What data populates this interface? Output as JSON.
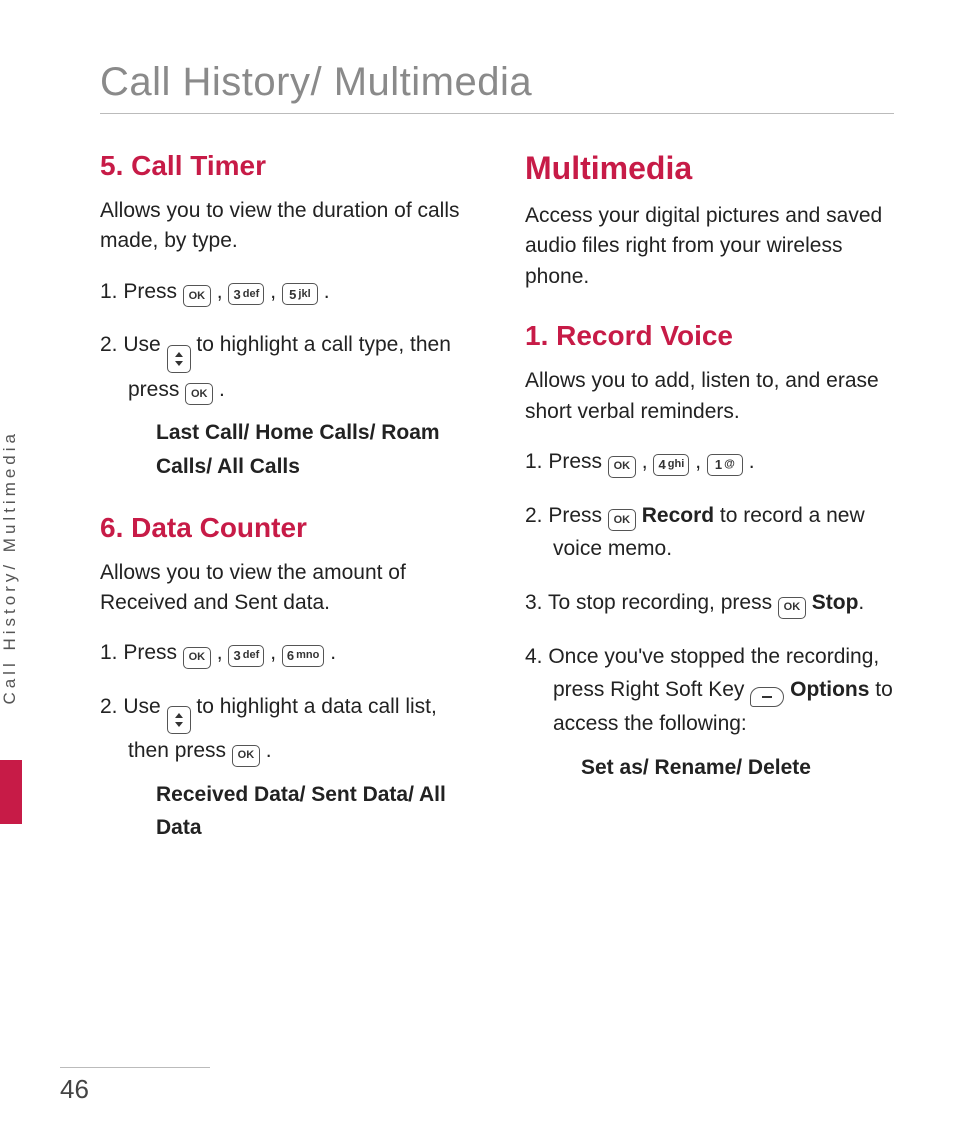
{
  "header": {
    "title": "Call History/ Multimedia"
  },
  "side_tab": "Call History/ Multimedia",
  "page_number": "46",
  "keys": {
    "ok": "OK",
    "k1": {
      "num": "1",
      "sub": "@"
    },
    "k3": {
      "num": "3",
      "sub": "def"
    },
    "k4": {
      "num": "4",
      "sub": "ghi"
    },
    "k5": {
      "num": "5",
      "sub": "jkl"
    },
    "k6": {
      "num": "6",
      "sub": "mno"
    }
  },
  "left": {
    "call_timer": {
      "title": "5. Call Timer",
      "desc": "Allows you to view the duration of calls made, by type.",
      "step1_a": "1. Press ",
      "step1_b": " , ",
      "step1_c": " , ",
      "step1_d": " .",
      "step2_a": "2. Use ",
      "step2_b": " to highlight a call type, then press ",
      "step2_c": " .",
      "sublist": "Last Call/ Home Calls/ Roam Calls/ All Calls"
    },
    "data_counter": {
      "title": "6. Data Counter",
      "desc": "Allows you to view the amount of Received and Sent data.",
      "step1_a": "1. Press ",
      "step1_b": " , ",
      "step1_c": " , ",
      "step1_d": " .",
      "step2_a": "2. Use ",
      "step2_b": " to highlight a data call list, then press ",
      "step2_c": " .",
      "sublist": "Received Data/ Sent Data/ All Data"
    }
  },
  "right": {
    "multimedia": {
      "title": "Multimedia",
      "desc": "Access your digital pictures and saved audio files right from your wireless phone."
    },
    "record_voice": {
      "title": "1. Record Voice",
      "desc": "Allows you to add, listen to, and erase short verbal reminders.",
      "step1_a": "1. Press ",
      "step1_b": " , ",
      "step1_c": " , ",
      "step1_d": " .",
      "step2_a": "2. Press ",
      "step2_b": " ",
      "step2_bold": "Record",
      "step2_c": " to record a new voice memo.",
      "step3_a": "3. To stop recording, press ",
      "step3_b": " ",
      "step3_bold": "Stop",
      "step3_c": ".",
      "step4_a": "4. Once you've stopped the recording, press Right Soft Key ",
      "step4_b": " ",
      "step4_bold": "Options",
      "step4_c": " to access the following:",
      "step4_sublist": "Set as/ Rename/ Delete"
    }
  }
}
